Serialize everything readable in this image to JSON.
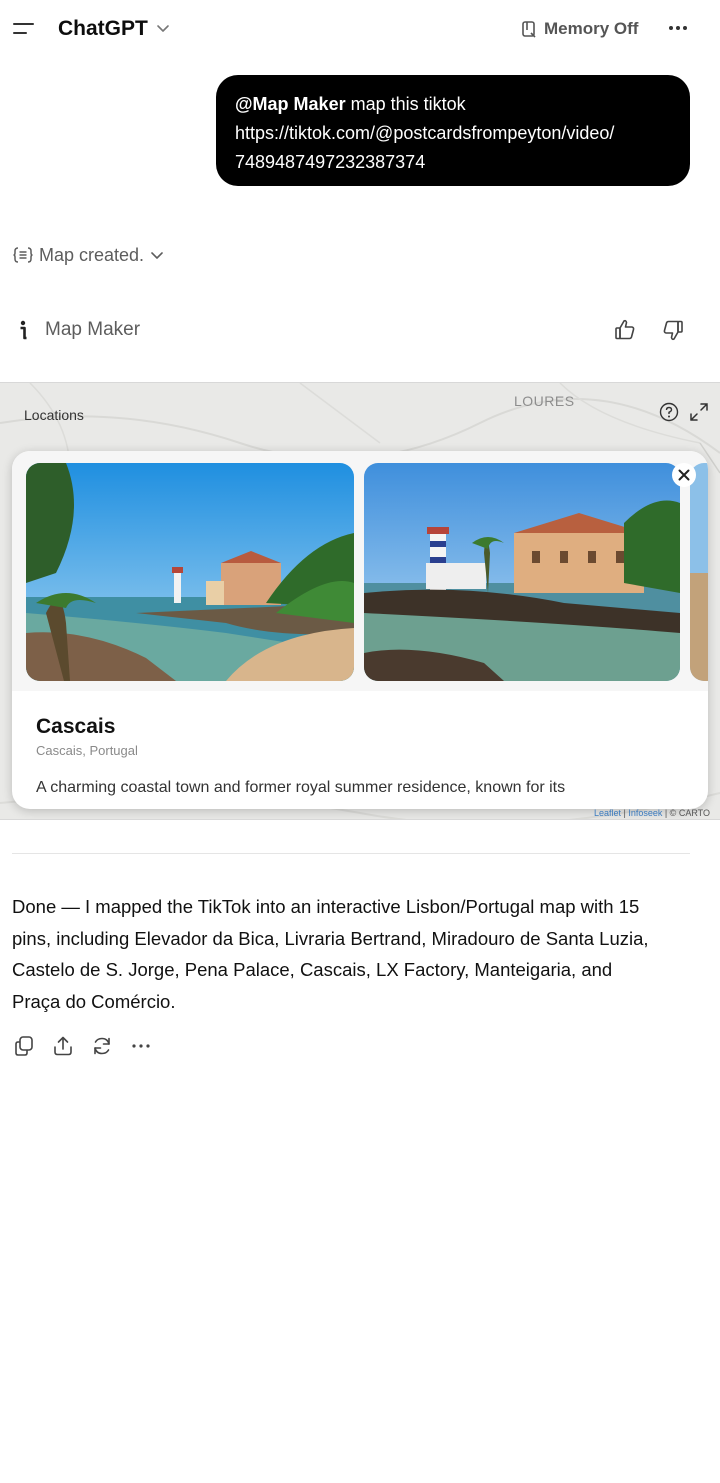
{
  "header": {
    "title": "ChatGPT",
    "memory_label": "Memory Off"
  },
  "user_message": {
    "mention": "@Map Maker",
    "line1_rest": " map this tiktok",
    "line2": "https://tiktok.com/@postcardsfrompeyton/video/",
    "line3": "7489487497232387374"
  },
  "status": {
    "label": "Map created."
  },
  "gpt": {
    "name": "Map Maker"
  },
  "map": {
    "panel_label": "Locations",
    "place_label": "LOURES",
    "attribution": {
      "leaflet": "Leaflet",
      "sep1": " | ",
      "infoseek": "Infoseek",
      "carto": " | © CARTO"
    }
  },
  "card": {
    "name": "Cascais",
    "location": "Cascais, Portugal",
    "description": "A charming coastal town and former royal summer residence, known for its"
  },
  "answer": {
    "line1": "Done — I mapped the TikTok into an interactive Lisbon/Portugal map with 15",
    "line2": "pins, including Elevador da Bica, Livraria Bertrand, Miradouro de Santa Luzia,",
    "line3": "Castelo de S. Jorge, Pena Palace, Cascais, LX Factory, Manteigaria, and",
    "line4": "Praça do Comércio."
  },
  "icons": [
    "menu-icon",
    "chevron-down-icon",
    "memory-icon",
    "more-icon",
    "thought-icon",
    "gpt-info-icon",
    "thumbs-up-icon",
    "thumbs-down-icon",
    "help-icon",
    "expand-icon",
    "close-icon",
    "copy-icon",
    "share-icon",
    "regenerate-icon",
    "more-actions-icon"
  ],
  "colors": {
    "user_bubble": "#000000",
    "muted_text": "#5d5d5d",
    "map_bg": "#e8e8e6"
  }
}
